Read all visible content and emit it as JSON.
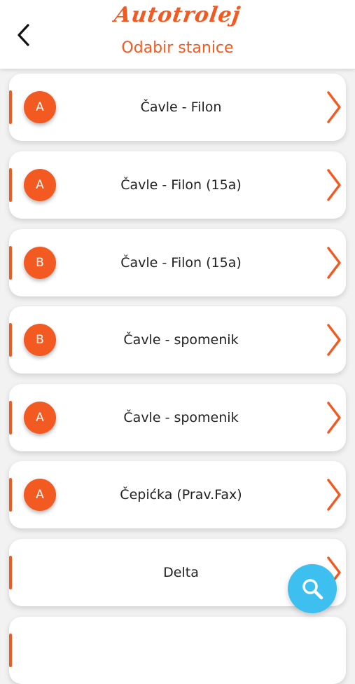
{
  "header": {
    "brand": "Autotrolej",
    "title": "Odabir stanice"
  },
  "stations": [
    {
      "badge": "A",
      "name": "Čavle - Filon"
    },
    {
      "badge": "A",
      "name": "Čavle - Filon (15a)"
    },
    {
      "badge": "B",
      "name": "Čavle - Filon (15a)"
    },
    {
      "badge": "B",
      "name": "Čavle - spomenik"
    },
    {
      "badge": "A",
      "name": "Čavle - spomenik"
    },
    {
      "badge": "A",
      "name": "Čepićka (Prav.Fax)"
    },
    {
      "badge": "",
      "name": "Delta"
    },
    {
      "badge": "",
      "name": ""
    }
  ],
  "icons": {
    "back": "chevron-left-icon",
    "row_arrow": "chevron-right-icon",
    "search": "search-icon"
  },
  "colors": {
    "accent": "#f25a22",
    "fab": "#3dbfef",
    "background": "#f2f2f2"
  }
}
